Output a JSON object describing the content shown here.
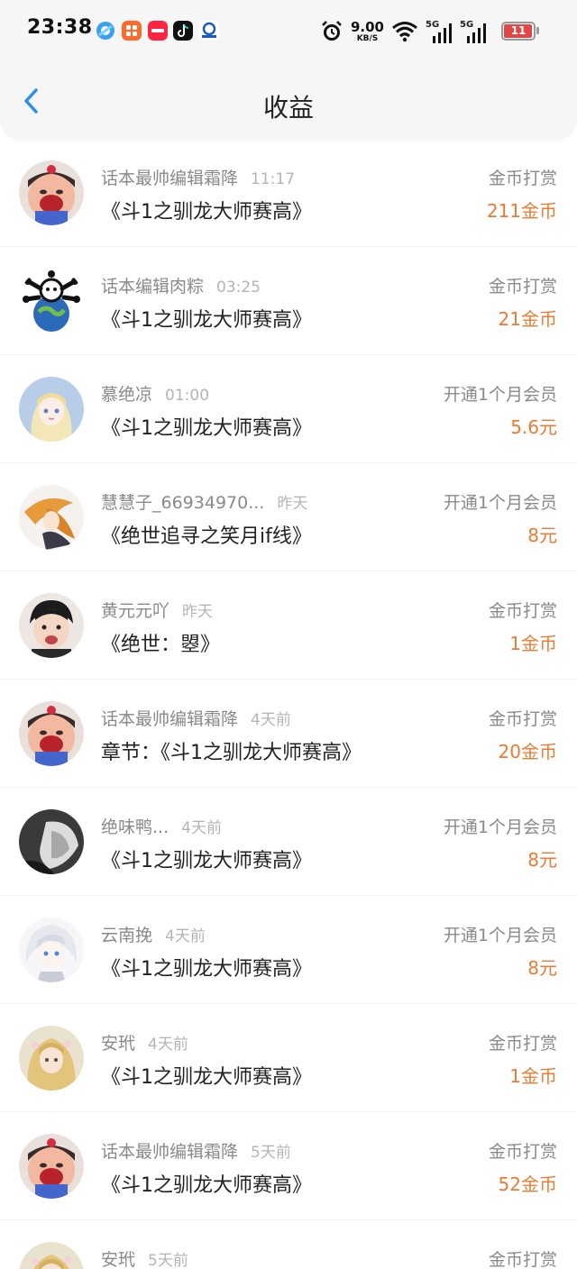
{
  "status_bar": {
    "time": "23:38",
    "net_speed_value": "9.00",
    "net_speed_unit": "KB/S",
    "signal_1": "5G",
    "signal_2": "5G",
    "battery_level": "11",
    "battery_fraction": 0.11,
    "app_icons": [
      "browser-icon",
      "xiaohongshu-alt-icon",
      "xiaohongshu-icon",
      "tiktok-icon",
      "bank-icon"
    ]
  },
  "header": {
    "title": "收益"
  },
  "colors": {
    "accent": "#2f8fe6",
    "amount": "#ea7a34",
    "battery_low": "#e04848"
  },
  "records": [
    {
      "name": "话本最帅编辑霜降",
      "time": "11:17",
      "work": "《斗1之驯龙大师赛高》",
      "type": "金币打赏",
      "amount": "211金币",
      "avatar": "cartoon-avatar-icon"
    },
    {
      "name": "话本编辑肉粽",
      "time": "03:25",
      "work": "《斗1之驯龙大师赛高》",
      "type": "金币打赏",
      "amount": "21金币",
      "avatar": "globe-avatar-icon"
    },
    {
      "name": "慕绝凉",
      "time": "01:00",
      "work": "《斗1之驯龙大师赛高》",
      "type": "开通1个月会员",
      "amount": "5.6元",
      "avatar": "anime-girl-avatar-icon"
    },
    {
      "name": "慧慧子_66934970...",
      "time": "昨天",
      "work": "《绝世追寻之笑月if线》",
      "type": "开通1个月会员",
      "amount": "8元",
      "avatar": "orange-hair-avatar-icon"
    },
    {
      "name": "黄元元吖",
      "time": "昨天",
      "work": "《绝世：曌》",
      "type": "金币打赏",
      "amount": "1金币",
      "avatar": "photo-avatar-icon"
    },
    {
      "name": "话本最帅编辑霜降",
      "time": "4天前",
      "work": "章节：《斗1之驯龙大师赛高》",
      "type": "金币打赏",
      "amount": "20金币",
      "avatar": "cartoon-avatar-icon"
    },
    {
      "name": "绝味鸭...",
      "time": "4天前",
      "work": "《斗1之驯龙大师赛高》",
      "type": "开通1个月会员",
      "amount": "8元",
      "avatar": "monochrome-avatar-icon"
    },
    {
      "name": "云南挽",
      "time": "4天前",
      "work": "《斗1之驯龙大师赛高》",
      "type": "开通1个月会员",
      "amount": "8元",
      "avatar": "white-hair-avatar-icon"
    },
    {
      "name": "安玳",
      "time": "4天前",
      "work": "《斗1之驯龙大师赛高》",
      "type": "金币打赏",
      "amount": "1金币",
      "avatar": "blonde-avatar-icon"
    },
    {
      "name": "话本最帅编辑霜降",
      "time": "5天前",
      "work": "《斗1之驯龙大师赛高》",
      "type": "金币打赏",
      "amount": "52金币",
      "avatar": "cartoon-avatar-icon"
    },
    {
      "name": "安玳",
      "time": "5天前",
      "work": "",
      "type": "金币打赏",
      "amount": "",
      "avatar": "blonde-avatar-icon"
    }
  ]
}
